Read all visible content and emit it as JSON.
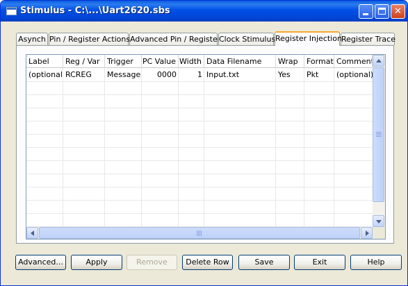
{
  "window": {
    "title": "Stimulus - C:\\...\\Uart2620.sbs"
  },
  "tabs": [
    {
      "label": "Asynch",
      "active": false
    },
    {
      "label": "Pin / Register Actions",
      "active": false
    },
    {
      "label": "Advanced Pin / Register",
      "active": false
    },
    {
      "label": "Clock Stimulus",
      "active": false
    },
    {
      "label": "Register Injection",
      "active": true
    },
    {
      "label": "Register Trace",
      "active": false
    }
  ],
  "grid": {
    "columns": [
      "Label",
      "Reg / Var",
      "Trigger",
      "PC Value",
      "Width",
      "Data Filename",
      "Wrap",
      "Format",
      "Comments"
    ],
    "rows": [
      [
        "(optional)",
        "RCREG",
        "Message",
        "0000",
        "1",
        "Input.txt",
        "Yes",
        "Pkt",
        "(optional)"
      ]
    ]
  },
  "buttons": {
    "advanced": "Advanced...",
    "apply": "Apply",
    "remove": "Remove",
    "delete_row": "Delete Row",
    "save": "Save",
    "exit": "Exit",
    "help": "Help"
  },
  "colors": {
    "titlebar": "#0054e3",
    "active_tab_accent": "#f5a832",
    "grid_border": "#7f9db9"
  }
}
